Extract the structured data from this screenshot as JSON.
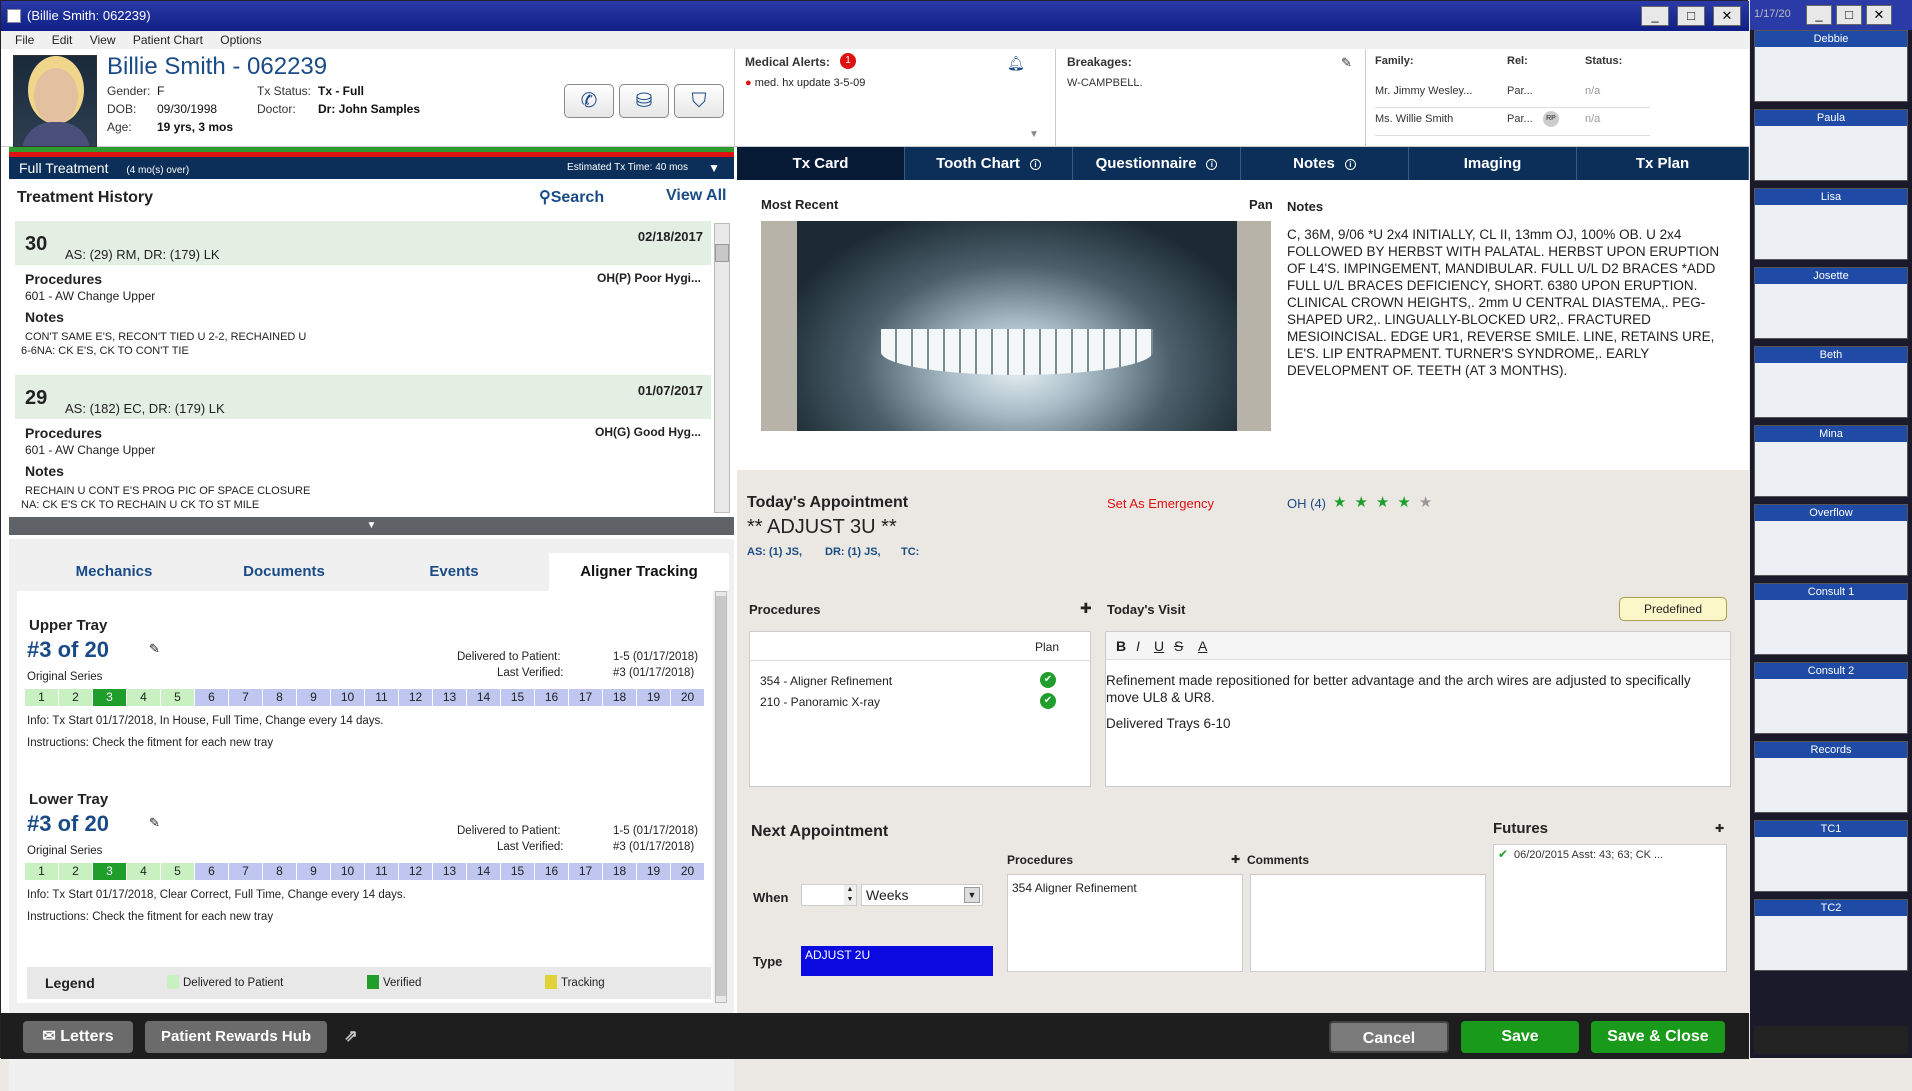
{
  "window": {
    "title": "(Billie Smith: 062239)",
    "side_title": "1/17/20"
  },
  "menu": [
    "File",
    "Edit",
    "View",
    "Patient Chart",
    "Options"
  ],
  "patient": {
    "name": "Billie Smith - 062239",
    "gender_label": "Gender:",
    "gender": "F",
    "dob_label": "DOB:",
    "dob": "09/30/1998",
    "age_label": "Age:",
    "age": "19 yrs, 3 mos",
    "status_label": "Tx Status:",
    "status": "Tx - Full",
    "doctor_label": "Doctor:",
    "doctor": "Dr: John Samples"
  },
  "alerts": {
    "label": "Medical Alerts:",
    "count": "1",
    "item": "med. hx update 3-5-09"
  },
  "breakages": {
    "label": "Breakages:",
    "value": "W-CAMPBELL."
  },
  "family": {
    "headers": [
      "Family:",
      "Rel:",
      "Status:"
    ],
    "rows": [
      {
        "name": "Mr. Jimmy Wesley...",
        "rel": "Par...",
        "badge": "",
        "status": "n/a"
      },
      {
        "name": "Ms. Willie Smith",
        "rel": "Par...",
        "badge": "RP",
        "status": "n/a"
      }
    ]
  },
  "tx_bar": {
    "title": "Full Treatment",
    "over": "(4 mo(s) over)",
    "estimate": "Estimated Tx Time: 40 mos"
  },
  "history": {
    "title": "Treatment History",
    "search": "Search",
    "view_all": "View All",
    "records": [
      {
        "num": "30",
        "date": "02/18/2017",
        "as": "AS: (29) RM, DR: (179) LK",
        "proc_label": "Procedures",
        "oh": "OH(P)  Poor Hygi...",
        "proc": "601 - AW Change Upper",
        "notes_label": "Notes",
        "notes1": "CON'T SAME E'S, RECON'T TIED U 2-2, RECHAINED U",
        "notes2": "6-6NA: CK E'S, CK TO CON'T TIE"
      },
      {
        "num": "29",
        "date": "01/07/2017",
        "as": "AS: (182) EC, DR: (179) LK",
        "proc_label": "Procedures",
        "oh": "OH(G)  Good Hyg...",
        "proc": "601 - AW Change Upper",
        "notes_label": "Notes",
        "notes1": "RECHAIN U CONT E'S PROG PIC OF SPACE CLOSURE",
        "notes2": "NA: CK E'S CK TO RECHAIN U CK TO ST MILE"
      }
    ]
  },
  "lower_tabs": [
    "Mechanics",
    "Documents",
    "Events",
    "Aligner Tracking"
  ],
  "aligner": {
    "delivered_label": "Delivered to Patient:",
    "verified_label": "Last Verified:",
    "series_label": "Original Series",
    "trays": [
      {
        "title": "Upper Tray",
        "count": "#3 of 20",
        "delivered": "1-5 (01/17/2018)",
        "verified": "#3 (01/17/2018)",
        "info": "Info: Tx Start 01/17/2018, In House, Full Time, Change every 14 days.",
        "instructions": "Instructions: Check the fitment for each new tray"
      },
      {
        "title": "Lower Tray",
        "count": "#3 of 20",
        "delivered": "1-5 (01/17/2018)",
        "verified": "#3 (01/17/2018)",
        "info": "Info: Tx Start 01/17/2018, Clear Correct, Full Time, Change every 14 days.",
        "instructions": "Instructions: Check the fitment for each new tray"
      }
    ],
    "legend": {
      "title": "Legend",
      "delivered": "Delivered to Patient",
      "verified": "Verified",
      "tracking": "Tracking"
    }
  },
  "tabs": [
    "Tx Card",
    "Tooth Chart",
    "Questionnaire",
    "Notes",
    "Imaging",
    "Tx Plan"
  ],
  "txcard": {
    "most_recent": "Most Recent",
    "pan": "Pan",
    "notes_label": "Notes",
    "notes": "C, 36M, 9/06          *U 2x4 INITIALLY,          CL II, 13mm OJ, 100% OB. U 2x4                    FOLLOWED BY HERBST        WITH PALATAL. HERBST                  UPON ERUPTION OF L4'S. IMPINGEMENT, MANDIBULAR. FULL U/L D2 BRACES      *ADD FULL U/L BRACES       DEFICIENCY, SHORT. 6380 UPON ERUPTION.              CLINICAL CROWN HEIGHTS,. 2mm U CENTRAL DIASTEMA,. PEG-SHAPED UR2,. LINGUALLY-BLOCKED UR2,. FRACTURED MESIOINCISAL. EDGE UR1, REVERSE SMILE. LINE, RETAINS URE, LE'S. LIP ENTRAPMENT. TURNER'S SYNDROME,. EARLY DEVELOPMENT OF. TEETH (AT 3 MONTHS)."
  },
  "today": {
    "title": "Today's Appointment",
    "emergency": "Set As Emergency",
    "oh": "OH (4)",
    "stars_filled": 4,
    "stars_total": 5,
    "appt": "** ADJUST 3U **",
    "as": "AS: (1) JS,",
    "dr": "DR: (1) JS,",
    "tc": "TC:",
    "procedures_label": "Procedures",
    "plan_label": "Plan",
    "procedures": [
      "354 - Aligner Refinement",
      "210 - Panoramic X-ray"
    ],
    "visit_label": "Today's Visit",
    "predefined": "Predefined",
    "visit_text1": "Refinement made repositioned for better advantage and the arch wires are adjusted to specifically move UL8 & UR8.",
    "visit_text2": "Delivered Trays 6-10"
  },
  "next": {
    "title": "Next Appointment",
    "when_label": "When",
    "unit": "Weeks",
    "type_label": "Type",
    "type_value": "ADJUST 2U",
    "procedures_label": "Procedures",
    "procedure": "354 Aligner Refinement",
    "comments_label": "Comments",
    "futures_label": "Futures",
    "future_item": "06/20/2015 Asst: 43; 63; CK ..."
  },
  "bottom": {
    "letters": "Letters",
    "rewards": "Patient Rewards Hub",
    "cancel": "Cancel",
    "save": "Save",
    "save_close": "Save & Close"
  },
  "schedule": [
    "Debbie",
    "Paula",
    "Lisa",
    "Josette",
    "Beth",
    "Mina",
    "Overflow",
    "Consult 1",
    "Consult 2",
    "Records",
    "TC1",
    "TC2"
  ],
  "colors": {
    "navy": "#0c2f5a",
    "accent": "#1a4b86",
    "green": "#1f9e2b",
    "delivered": "#c8f0c0",
    "pending": "#bfc7f0"
  }
}
